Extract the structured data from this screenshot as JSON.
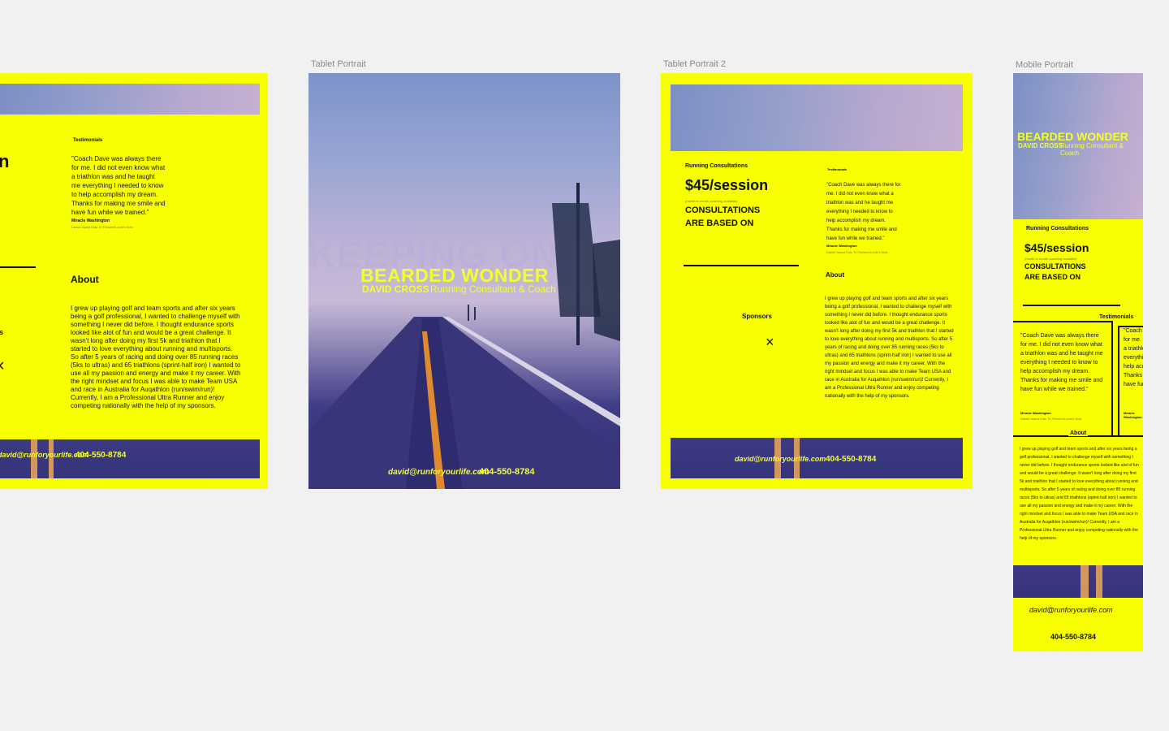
{
  "artboards": {
    "desktop": {
      "label": ""
    },
    "tablet": {
      "label": "Tablet Portrait"
    },
    "tablet2": {
      "label": "Tablet Portrait 2"
    },
    "mobile": {
      "label": "Mobile Portrait"
    }
  },
  "brand": {
    "title": "BEARDED WONDER",
    "name": "DAVID CROSS",
    "role": "Running Consultant & Coach",
    "overlay": "KEEPING ON"
  },
  "contact": {
    "email": "david@runforyourlife.com",
    "phone": "404-550-8784"
  },
  "consult": {
    "heading": "Running Consultations",
    "price": "$45/session",
    "note": "(month to month coaching available)",
    "tagline_line1": "CONSULTATIONS",
    "tagline_line2": "ARE BASED ON"
  },
  "testimonials": {
    "heading": "Testimonials",
    "quote": "\"Coach Dave was always there for me. I did not even know what a triathlon was and he taught me everything I needed to know to help accomplish my dream. Thanks for making me smile and have fun while we trained.\"",
    "author": "Miracle Washington",
    "author_sub": "Daniel Island Kids Tri Finisher/Louie's Kids"
  },
  "about": {
    "heading": "About",
    "body": "I grew up playing golf and team sports and after six years being a golf professional, I wanted to challenge myself with something I never did before. I thought endurance sports looked like alot of fun and would be a great challenge. It wasn't long after doing my first 5k and triathlon that I started to love everything about running and multisports. So after 5 years of racing and doing over 85 running races (5ks to ultras) and 65 triathlons (sprint-half iron) I wanted to use all my passion and energy and make it my career. With the right mindset and focus I was able to make Team USA and race in Australia for Auqathlon (run/swim/run)! Currently, I am a Professional Ultra Runner and enjoy competing nationally with the help of my sponsors."
  },
  "sponsors": {
    "heading": "Sponsors",
    "heading_partial": "s"
  },
  "desktop_partial": {
    "headline_letter": "n"
  },
  "icons": {
    "close": "×"
  },
  "colors": {
    "accent_yellow": "#f7ff00",
    "road_purple": "#3c3a82",
    "canvas": "#f1f1f1"
  }
}
